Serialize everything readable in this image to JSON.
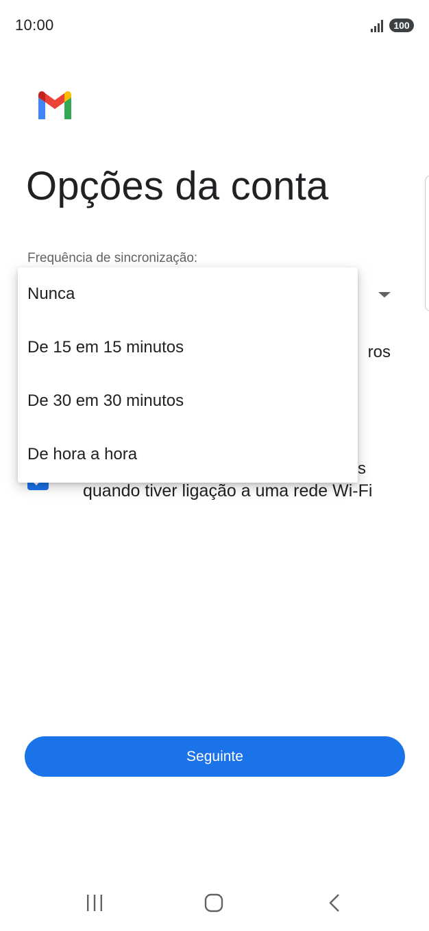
{
  "status_bar": {
    "time": "10:00",
    "battery": "100",
    "signal_icon": "signal-bars-icon"
  },
  "header": {
    "logo_icon": "gmail-logo",
    "title": "Opções da conta"
  },
  "sync": {
    "label": "Frequência de sincronização:",
    "dropdown_options": [
      "Nunca",
      "De 15 em 15 minutos",
      "De 30 em 30 minutos",
      "De hora a hora"
    ]
  },
  "background_fragments": {
    "row1_tail": "ros",
    "row2_tail": "s"
  },
  "wifi_option": {
    "label": "quando tiver ligação a uma rede Wi-Fi",
    "checked": true
  },
  "footer": {
    "next_label": "Seguinte"
  },
  "navigation": {
    "recents_icon": "recents-icon",
    "home_icon": "home-icon",
    "back_icon": "back-icon"
  },
  "colors": {
    "accent": "#1a73e8",
    "text_primary": "#202124",
    "text_secondary": "#5f6368"
  }
}
